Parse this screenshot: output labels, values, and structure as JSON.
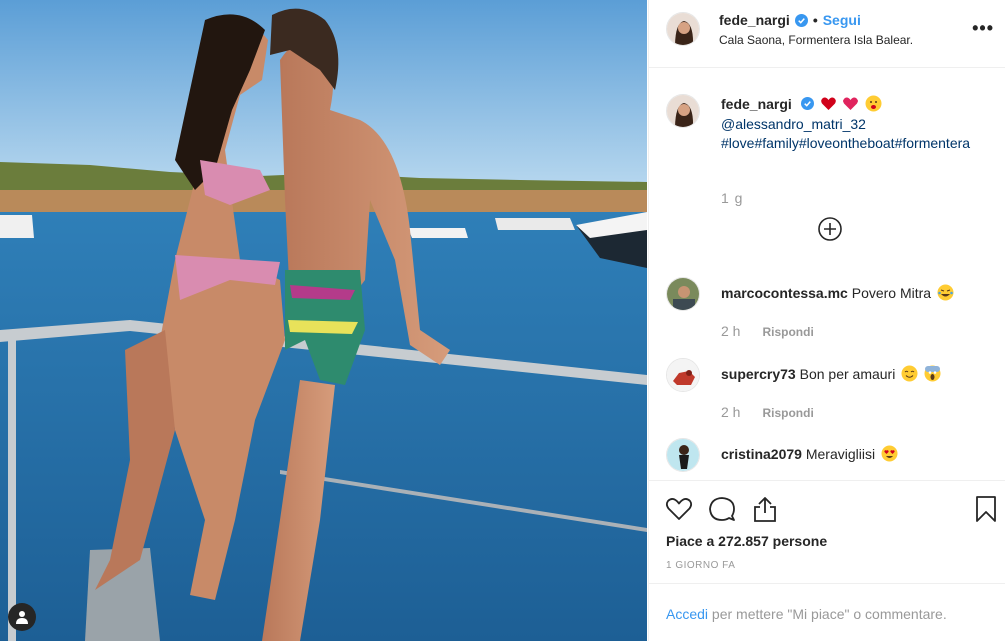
{
  "post": {
    "author": "fede_nargi",
    "follow_label": "Segui",
    "separator": "•",
    "location": "Cala Saona, Formentera Isla Balear.",
    "more_label": "•••",
    "caption": {
      "mention": "@alessandro_matri_32",
      "hashtags": "#love#family#loveontheboat#formentera",
      "time": "1 g"
    },
    "comments": [
      {
        "user": "marcocontessa.mc",
        "text": "Povero Mitra",
        "time": "2 h",
        "reply": "Rispondi"
      },
      {
        "user": "supercry73",
        "text": "Bon per amauri",
        "time": "2 h",
        "reply": "Rispondi"
      },
      {
        "user": "cristina2079",
        "text": "Meravigliisi",
        "time": "",
        "reply": ""
      }
    ],
    "likes": "Piace a 272.857 persone",
    "date": "1 GIORNO FA",
    "login": {
      "link": "Accedi",
      "rest": "per mettere \"Mi piace\" o commentare."
    }
  },
  "colors": {
    "accent": "#3897f0",
    "muted": "#999999",
    "link": "#003569",
    "border": "#efefef"
  },
  "icons": [
    "user-tag-icon",
    "verified-badge-icon",
    "more-options-icon",
    "load-more-comments-icon",
    "heart-icon",
    "comment-icon",
    "share-icon",
    "bookmark-icon"
  ]
}
